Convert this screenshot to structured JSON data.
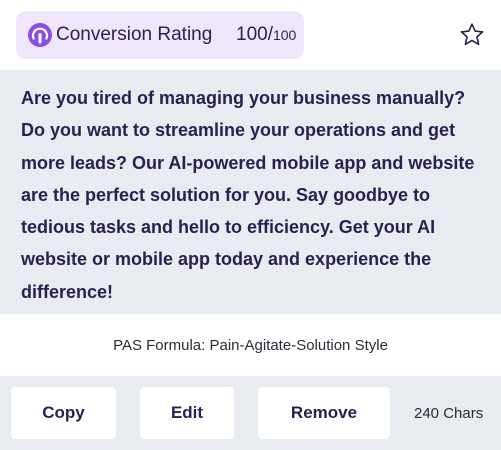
{
  "rating": {
    "label": "Conversion Rating",
    "score": "100",
    "separator": "/",
    "max": "100",
    "icon": "gauge-icon",
    "accent": "#8a4fe0"
  },
  "favorite": {
    "icon": "star-outline-icon"
  },
  "content": {
    "text": "Are you tired of managing your business manually? Do you want to streamline your operations and get more leads? Our AI-powered mobile app and website are the perfect solution for you. Say goodbye to tedious tasks and hello to efficiency. Get your AI website or mobile app today and experience the difference!"
  },
  "formula": {
    "label": "PAS Formula: Pain-Agitate-Solution Style"
  },
  "actions": {
    "copy_label": "Copy",
    "edit_label": "Edit",
    "remove_label": "Remove",
    "char_count": "240 Chars"
  },
  "colors": {
    "panel_bg": "#e8ebef",
    "pill_bg": "#efe6fb",
    "text_dark": "#2a2152"
  }
}
